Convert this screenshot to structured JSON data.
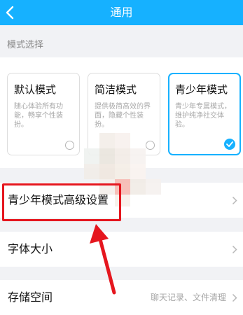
{
  "header": {
    "title": "通用",
    "back_icon": "chevron-left-icon",
    "background": "#16b1ff"
  },
  "mode_section": {
    "label": "模式选择",
    "cards": [
      {
        "title": "默认模式",
        "description": "随心体验所有功能，畅享个性装扮。",
        "selected": false
      },
      {
        "title": "简洁模式",
        "description": "提供极简高效的界面，隐藏个性装扮。",
        "selected": false
      },
      {
        "title": "青少年模式",
        "description": "青少年专属模式，维护纯净社交体验。",
        "selected": true
      }
    ]
  },
  "rows": [
    {
      "label": "青少年模式高级设置",
      "value": ""
    },
    {
      "label": "字体大小",
      "value": ""
    },
    {
      "label": "存储空间",
      "value": "聊天记录、文件清理"
    }
  ],
  "colors": {
    "accent": "#16b1ff",
    "annotation": "#e5161e"
  }
}
